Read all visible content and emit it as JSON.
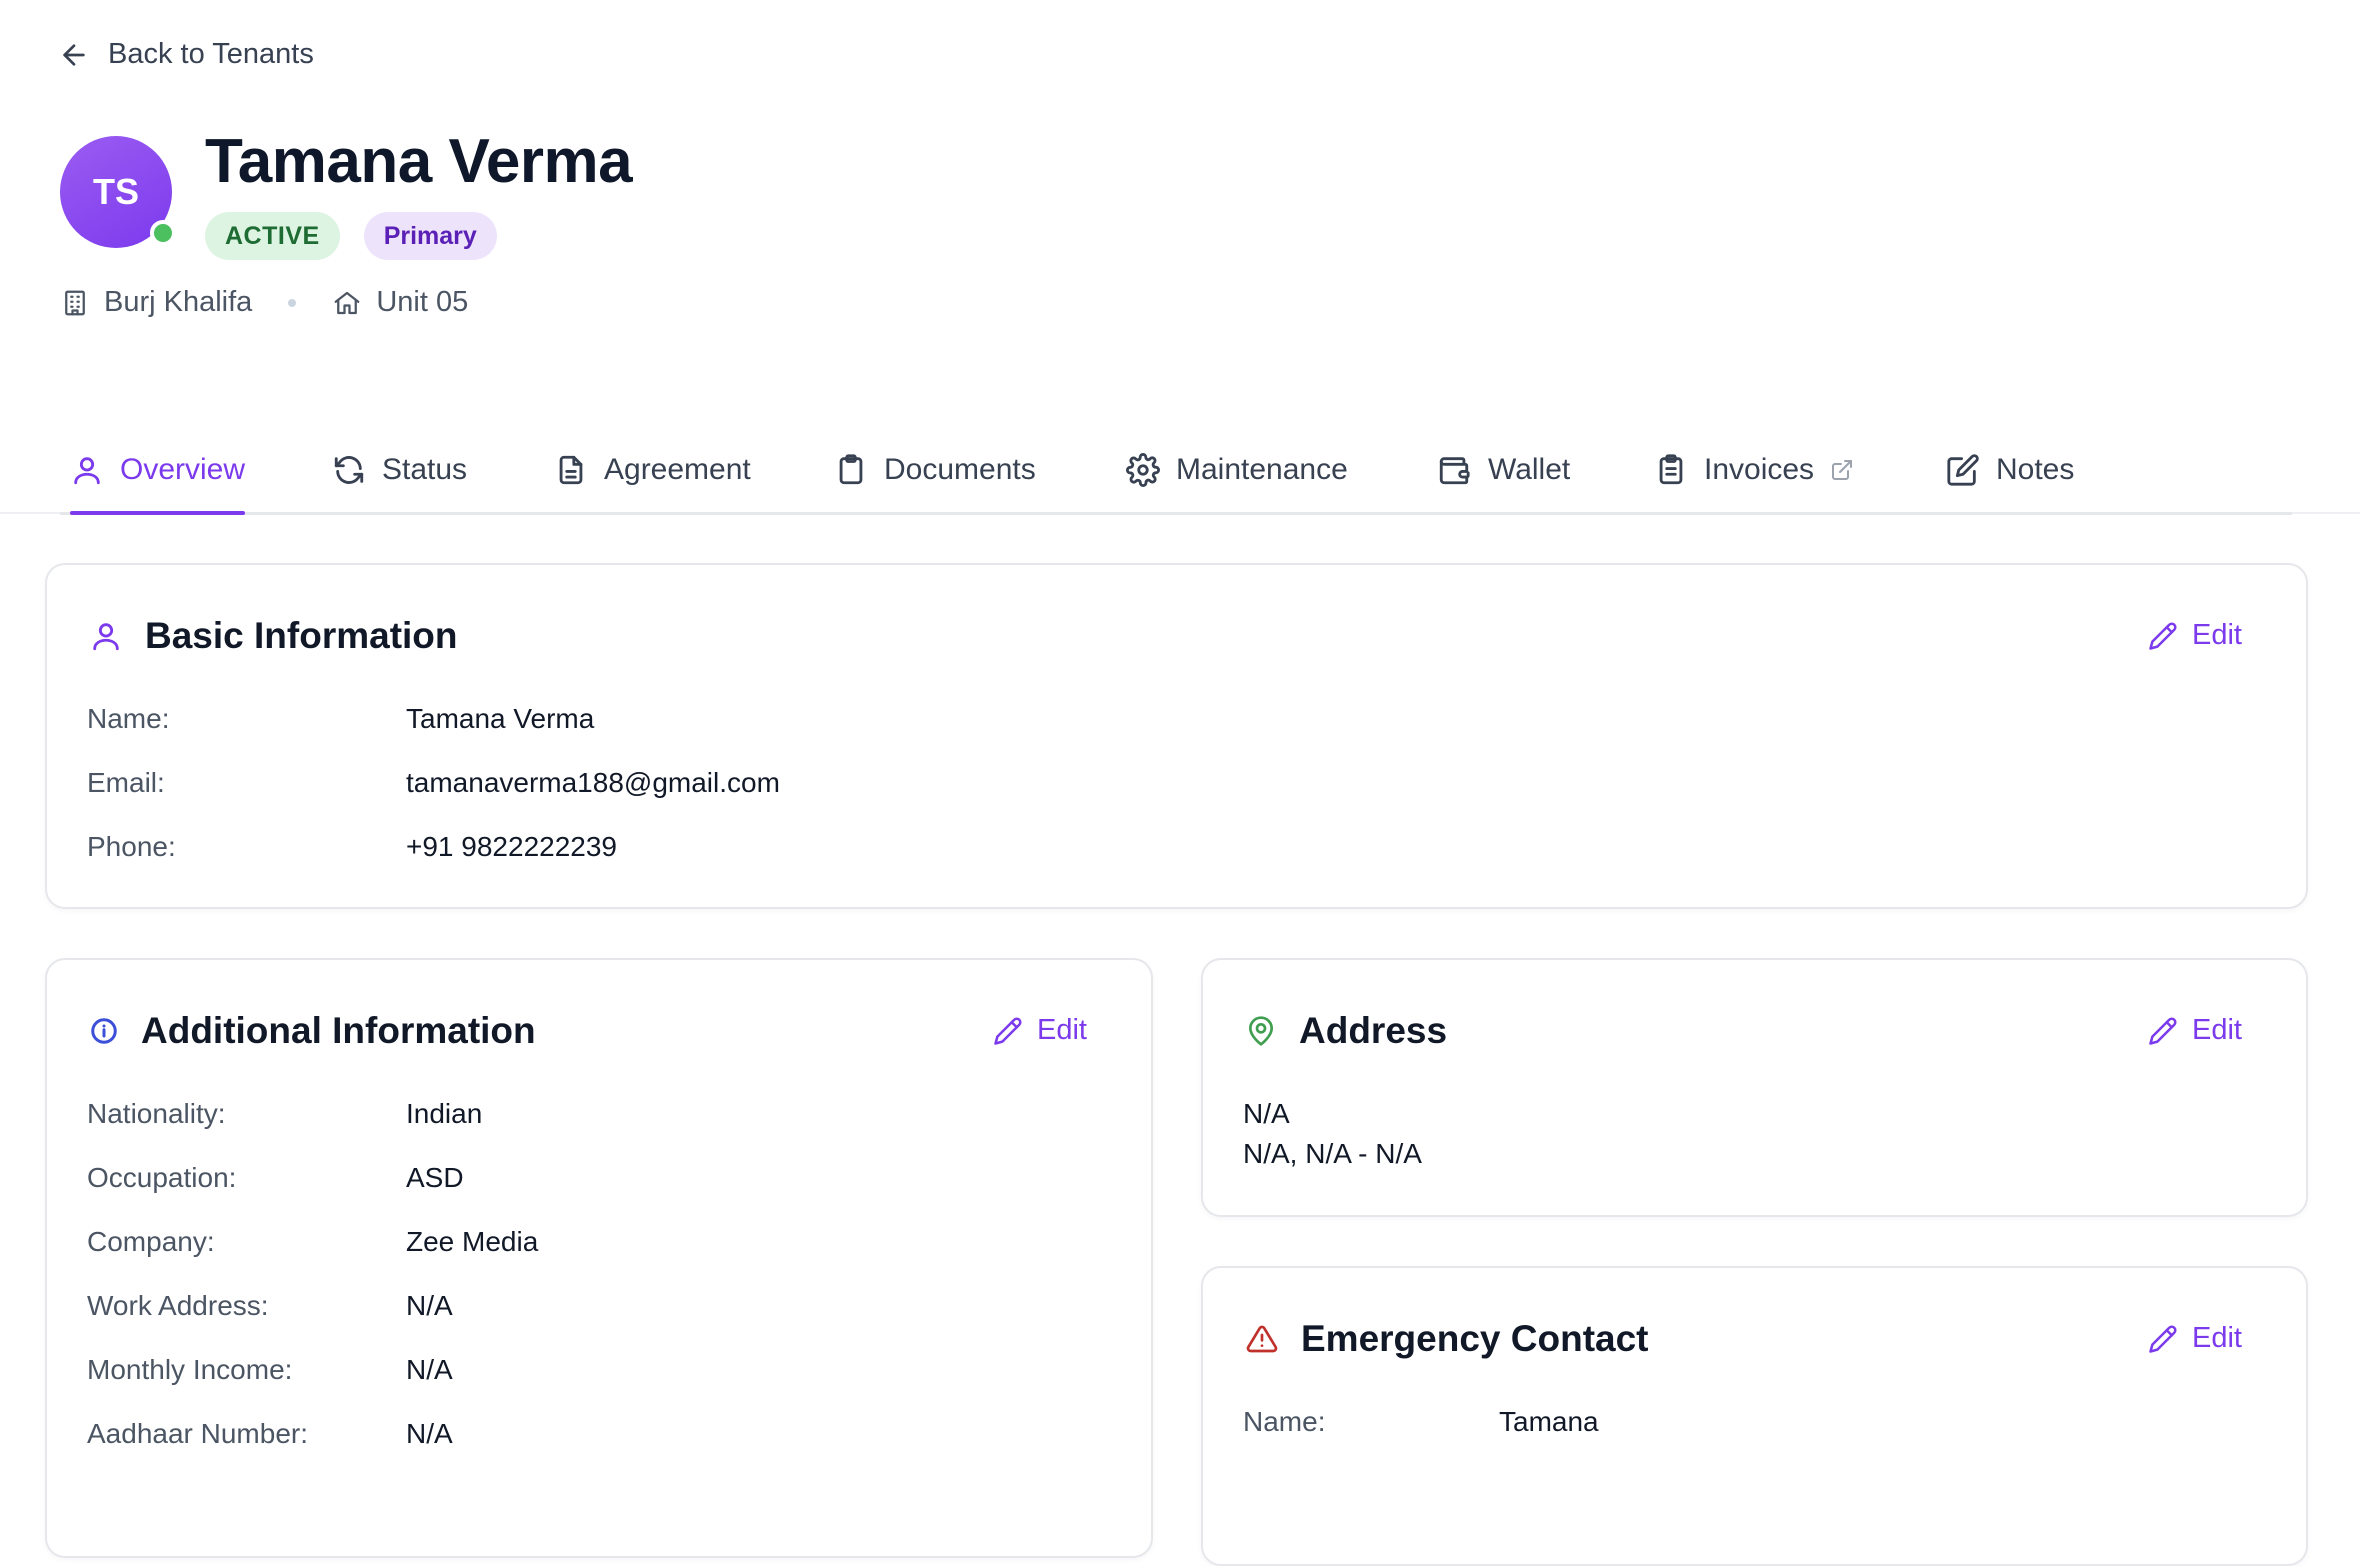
{
  "header": {
    "back_label": "Back to Tenants",
    "avatar_initials": "TS",
    "tenant_name": "Tamana Verma",
    "status_badge": "ACTIVE",
    "type_badge": "Primary",
    "building": "Burj Khalifa",
    "unit": "Unit 05"
  },
  "tabs": [
    {
      "label": "Overview",
      "icon": "user-icon",
      "selected": true
    },
    {
      "label": "Status",
      "icon": "refresh-icon"
    },
    {
      "label": "Agreement",
      "icon": "file-text-icon"
    },
    {
      "label": "Documents",
      "icon": "clipboard-icon"
    },
    {
      "label": "Maintenance",
      "icon": "gear-icon"
    },
    {
      "label": "Wallet",
      "icon": "wallet-icon"
    },
    {
      "label": "Invoices",
      "icon": "clipboard-list-icon",
      "external": true
    },
    {
      "label": "Notes",
      "icon": "edit-icon"
    }
  ],
  "basic_info": {
    "title": "Basic Information",
    "edit_label": "Edit",
    "rows": [
      {
        "label": "Name:",
        "value": "Tamana Verma"
      },
      {
        "label": "Email:",
        "value": "tamanaverma188@gmail.com"
      },
      {
        "label": "Phone:",
        "value": "+91 9822222239"
      }
    ]
  },
  "additional_info": {
    "title": "Additional Information",
    "edit_label": "Edit",
    "rows": [
      {
        "label": "Nationality:",
        "value": "Indian"
      },
      {
        "label": "Occupation:",
        "value": "ASD"
      },
      {
        "label": "Company:",
        "value": "Zee Media"
      },
      {
        "label": "Work Address:",
        "value": "N/A"
      },
      {
        "label": "Monthly Income:",
        "value": "N/A"
      },
      {
        "label": "Aadhaar Number:",
        "value": "N/A"
      }
    ]
  },
  "address": {
    "title": "Address",
    "edit_label": "Edit",
    "line1": "N/A",
    "line2": "N/A, N/A - N/A"
  },
  "emergency_contact": {
    "title": "Emergency Contact",
    "edit_label": "Edit",
    "rows": [
      {
        "label": "Name:",
        "value": "Tamana"
      }
    ]
  },
  "colors": {
    "accent": "#7c3aed",
    "active_badge_bg": "#dcf4e1",
    "primary_badge_bg": "#ede4fc",
    "online": "#4cbf5e",
    "address_icon": "#3f9e4f",
    "warning_icon": "#c0312b",
    "info_icon": "#3b4fd9"
  }
}
